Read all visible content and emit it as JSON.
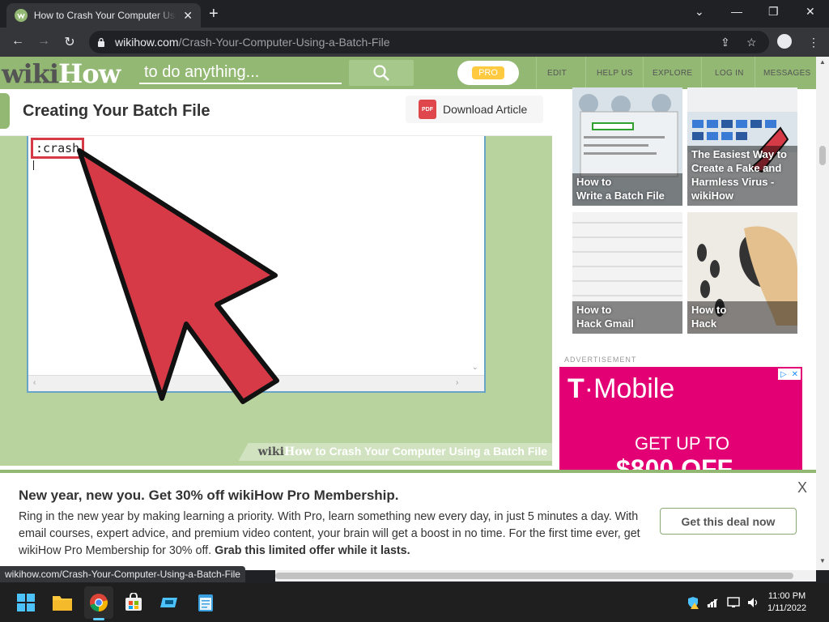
{
  "browser": {
    "tab_title": "How to Crash Your Computer Using a Batch File",
    "tab_close": "✕",
    "new_tab": "+",
    "url_host": "wikihow.com",
    "url_path": "/Crash-Your-Computer-Using-a-Batch-File",
    "status_url": "wikihow.com/Crash-Your-Computer-Using-a-Batch-File"
  },
  "header": {
    "logo_wiki": "wiki",
    "logo_how": "How",
    "search_placeholder": "to do anything...",
    "pro_label": "PRO",
    "nav": [
      "EDIT",
      "HELP US",
      "EXPLORE",
      "LOG IN",
      "MESSAGES"
    ]
  },
  "section": {
    "title": "Creating Your Batch File",
    "download_label": "Download Article",
    "pdf_badge": "PDF"
  },
  "step_image": {
    "code_label": ":crash",
    "watermark_wiki": "wiki",
    "watermark_how": "How",
    "watermark_text": " to Crash Your Computer Using a Batch File"
  },
  "related": [
    {
      "caption_line1": "How to",
      "caption_line2": "Write a Batch File"
    },
    {
      "caption_line1": "The Easiest Way to",
      "caption_line2": "Create a Fake and",
      "caption_line3": "Harmless Virus -",
      "caption_line4": "wikiHow"
    },
    {
      "caption_line1": "How to",
      "caption_line2": "Hack Gmail"
    },
    {
      "caption_line1": "How to",
      "caption_line2": "Hack"
    }
  ],
  "ad": {
    "label": "ADVERTISEMENT",
    "brand_t": "T",
    "brand_rest": "Mobile",
    "headline": "GET UP TO",
    "price": "$800 OFF",
    "brand_color": "#e20074"
  },
  "promo": {
    "title": "New year, new you. Get 30% off wikiHow Pro Membership.",
    "body": "Ring in the new year by making learning a priority. With Pro, learn something new every day, in just 5 minutes a day. With email courses, expert advice, and premium video content, your brain will get a boost in no time. For the first time ever, get wikiHow Pro Membership for 30% off. ",
    "body_bold": "Grab this limited offer while it lasts.",
    "button": "Get this deal now",
    "close": "X"
  },
  "taskbar": {
    "time": "11:00 PM",
    "date": "1/11/2022"
  },
  "colors": {
    "wikihow_green": "#93b874",
    "arrow_red": "#d63a47"
  }
}
